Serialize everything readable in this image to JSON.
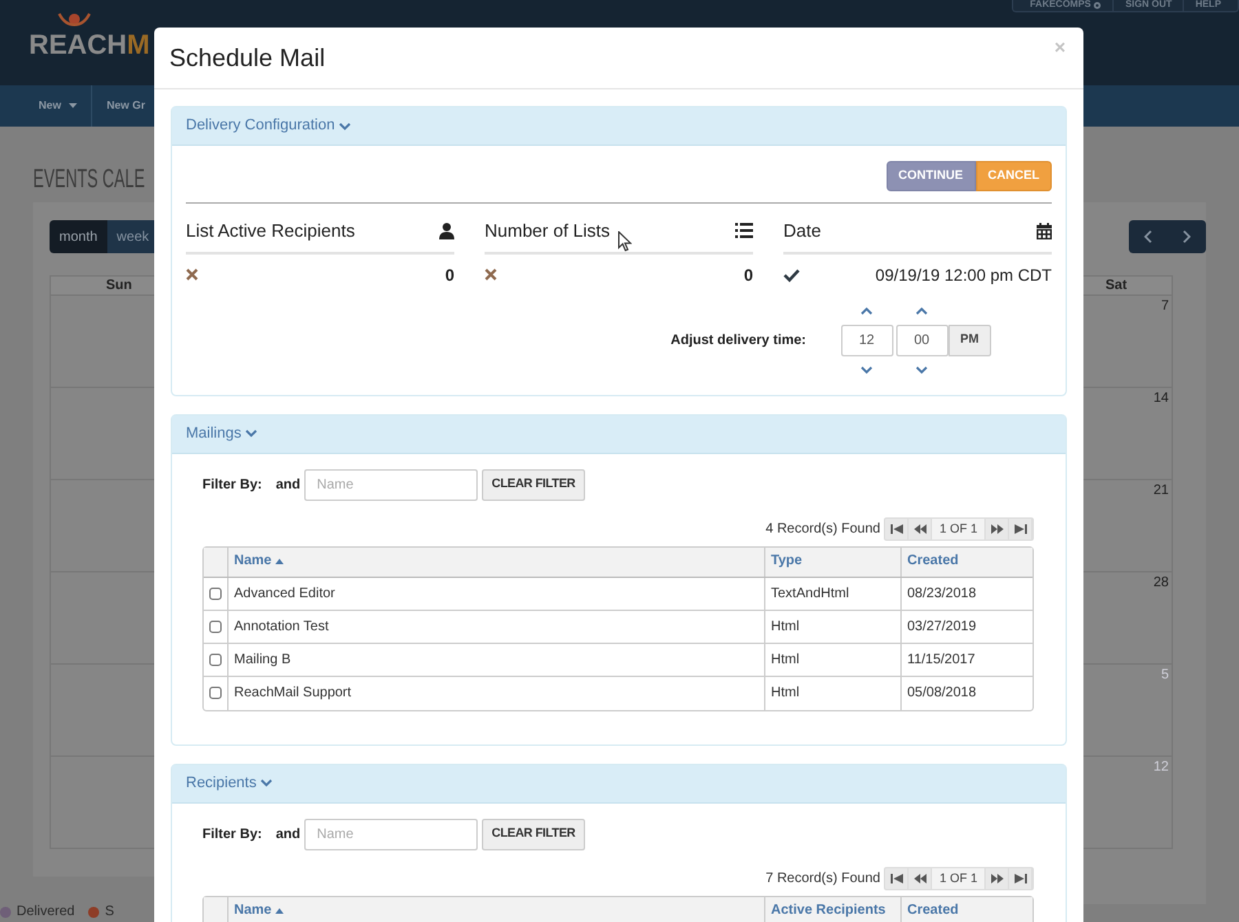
{
  "app": {
    "logo": {
      "main": "REACH",
      "accent": "M"
    },
    "top_links": [
      "FAKECOMPS",
      "SIGN OUT",
      "HELP"
    ],
    "nav": [
      {
        "label": "New",
        "kind": "dropdown"
      },
      {
        "label": "New Gr",
        "kind": "link"
      }
    ],
    "page_title": "EVENTS CALE",
    "view_tabs": [
      {
        "label": "month",
        "selected": true
      },
      {
        "label": "week",
        "selected": false
      }
    ],
    "calendar": {
      "left_column": "Sun",
      "right_column": "Sat",
      "right_days": [
        {
          "label": "7",
          "other_month": false
        },
        {
          "label": "14",
          "other_month": false
        },
        {
          "label": "21",
          "other_month": false
        },
        {
          "label": "28",
          "other_month": false
        },
        {
          "label": "5",
          "other_month": true
        },
        {
          "label": "12",
          "other_month": true
        }
      ]
    },
    "legend": [
      {
        "label": "Delivered",
        "color": "#6f5f78"
      },
      {
        "label": "S",
        "color": "#8e3d27"
      }
    ]
  },
  "modal": {
    "title": "Schedule Mail",
    "close": "×",
    "delivery": {
      "title": "Delivery Configuration",
      "expanded": true,
      "buttons": [
        {
          "label": "CONTINUE",
          "kind": "secondary"
        },
        {
          "label": "CANCEL",
          "kind": "warning"
        }
      ],
      "stats": [
        {
          "title": "List Active Recipients",
          "kind": "person",
          "ok": false,
          "value": "0"
        },
        {
          "title": "Number of Lists",
          "kind": "list",
          "ok": false,
          "value": "0"
        },
        {
          "title": "Date",
          "kind": "calendar",
          "ok": true,
          "value": "09/19/19 12:00 pm CDT"
        }
      ],
      "adjust": {
        "label": "Adjust delivery time:",
        "hour": "12",
        "minute": "00",
        "meridiem": "PM"
      }
    },
    "sections": [
      {
        "title": "Mailings",
        "expanded": true,
        "filter_label": "Filter By:",
        "joiner": "and",
        "placeholder": "Name",
        "clear": "CLEAR FILTER",
        "records": "4 Record(s) Found",
        "page": "1 OF 1",
        "columns": [
          {
            "label": "Name",
            "sorted": true
          },
          {
            "label": "Type",
            "sorted": false
          },
          {
            "label": "Created",
            "sorted": false
          }
        ],
        "rows": [
          {
            "checked": false,
            "cells": [
              "Advanced Editor",
              "TextAndHtml",
              "08/23/2018"
            ]
          },
          {
            "checked": false,
            "cells": [
              "Annotation Test",
              "Html",
              "03/27/2019"
            ]
          },
          {
            "checked": false,
            "cells": [
              "Mailing B",
              "Html",
              "11/15/2017"
            ]
          },
          {
            "checked": false,
            "cells": [
              "ReachMail Support",
              "Html",
              "05/08/2018"
            ]
          }
        ]
      },
      {
        "title": "Recipients",
        "expanded": true,
        "filter_label": "Filter By:",
        "joiner": "and",
        "placeholder": "Name",
        "clear": "CLEAR FILTER",
        "records": "7 Record(s) Found",
        "page": "1 OF 1",
        "columns": [
          {
            "label": "Name",
            "sorted": true
          },
          {
            "label": "Active Recipients",
            "sorted": false
          },
          {
            "label": "Created",
            "sorted": false
          }
        ]
      }
    ]
  }
}
